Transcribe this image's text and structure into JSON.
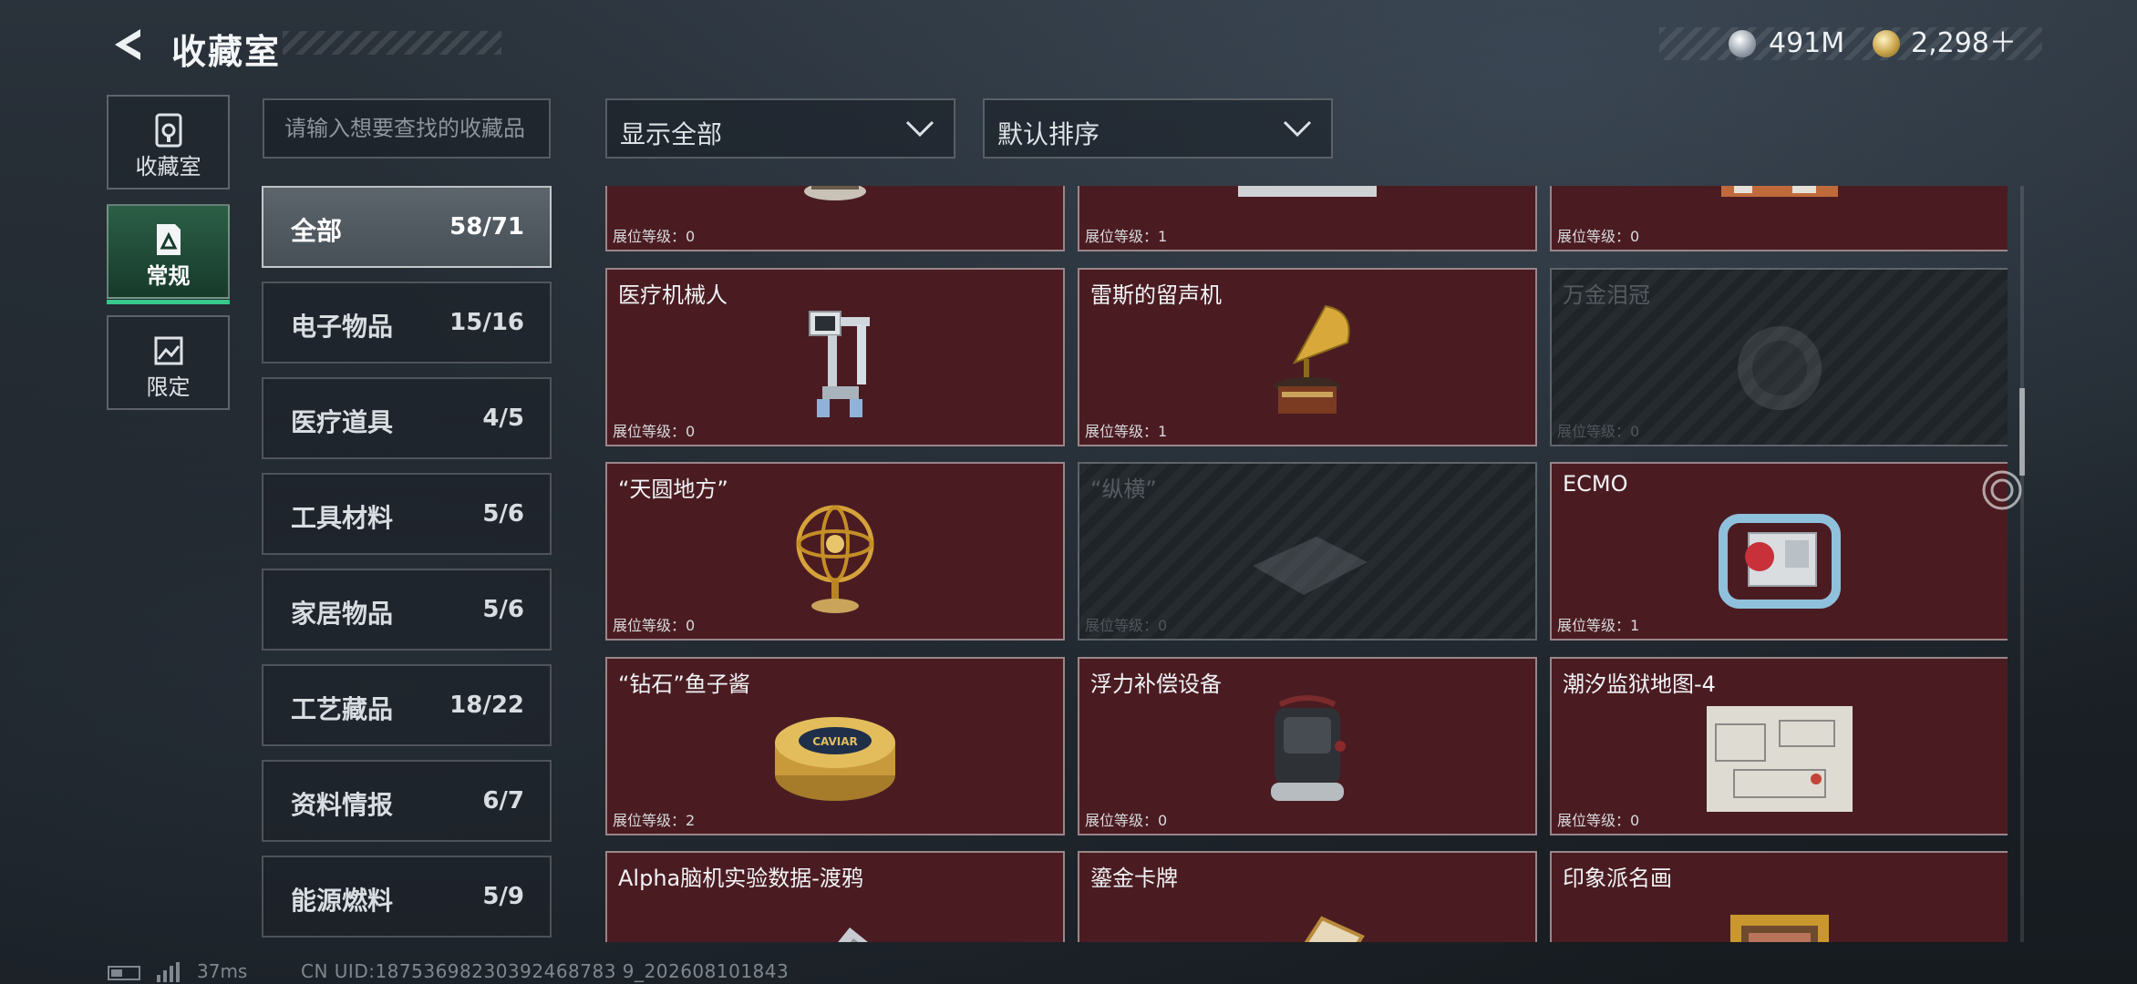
{
  "header": {
    "title": "收藏室",
    "back_icon": "back-arrow-icon"
  },
  "currency": {
    "silver": {
      "icon": "silver-coin-icon",
      "amount": "491M"
    },
    "gold": {
      "icon": "gold-coin-icon",
      "amount": "2,298＋"
    }
  },
  "side_tabs": [
    {
      "label": "收藏室",
      "icon": "vault-icon",
      "active": false
    },
    {
      "label": "常规",
      "icon": "document-icon",
      "active": true
    },
    {
      "label": "限定",
      "icon": "picture-icon",
      "active": false
    }
  ],
  "search": {
    "placeholder": "请输入想要查找的收藏品",
    "value": ""
  },
  "filters": {
    "display": "显示全部",
    "sort": "默认排序"
  },
  "categories": [
    {
      "name": "全部",
      "count": "58/71",
      "active": true
    },
    {
      "name": "电子物品",
      "count": "15/16"
    },
    {
      "name": "医疗道具",
      "count": "4/5"
    },
    {
      "name": "工具材料",
      "count": "5/6"
    },
    {
      "name": "家居物品",
      "count": "5/6"
    },
    {
      "name": "工艺藏品",
      "count": "18/22"
    },
    {
      "name": "资料情报",
      "count": "6/7"
    },
    {
      "name": "能源燃料",
      "count": "5/9"
    }
  ],
  "grid": {
    "rows": [
      [
        {
          "name": "",
          "level": "展位等级：0",
          "locked": false,
          "art": "chandelier"
        },
        {
          "name": "",
          "level": "展位等级：1",
          "locked": false,
          "art": "device"
        },
        {
          "name": "",
          "level": "展位等级：0",
          "locked": false,
          "art": "parts"
        }
      ],
      [
        {
          "name": "医疗机械人",
          "level": "展位等级：0",
          "locked": false,
          "art": "robot"
        },
        {
          "name": "雷斯的留声机",
          "level": "展位等级：1",
          "locked": false,
          "art": "gramophone"
        },
        {
          "name": "万金泪冠",
          "level": "展位等级：0",
          "locked": true,
          "art": "crown"
        }
      ],
      [
        {
          "name": "“天圆地方”",
          "level": "展位等级：0",
          "locked": false,
          "art": "globe"
        },
        {
          "name": "“纵横”",
          "level": "展位等级：0",
          "locked": true,
          "art": "board"
        },
        {
          "name": "ECMO",
          "level": "展位等级：1",
          "locked": false,
          "art": "ecmo"
        }
      ],
      [
        {
          "name": "“钻石”鱼子酱",
          "level": "展位等级：2",
          "locked": false,
          "art": "caviar"
        },
        {
          "name": "浮力补偿设备",
          "level": "展位等级：0",
          "locked": false,
          "art": "backpack"
        },
        {
          "name": "潮汐监狱地图-4",
          "level": "展位等级：0",
          "locked": false,
          "art": "map"
        }
      ],
      [
        {
          "name": "Alpha脑机实验数据-渡鸦",
          "level": "",
          "locked": false,
          "art": "cylinder"
        },
        {
          "name": "鎏金卡牌",
          "level": "",
          "locked": false,
          "art": "card"
        },
        {
          "name": "印象派名画",
          "level": "",
          "locked": false,
          "art": "painting"
        }
      ]
    ]
  },
  "caviar_label": "CAVIAR",
  "status_bar": {
    "ping": "37ms",
    "uid": "CN UID:18753698230392468783 9_202608101843"
  }
}
